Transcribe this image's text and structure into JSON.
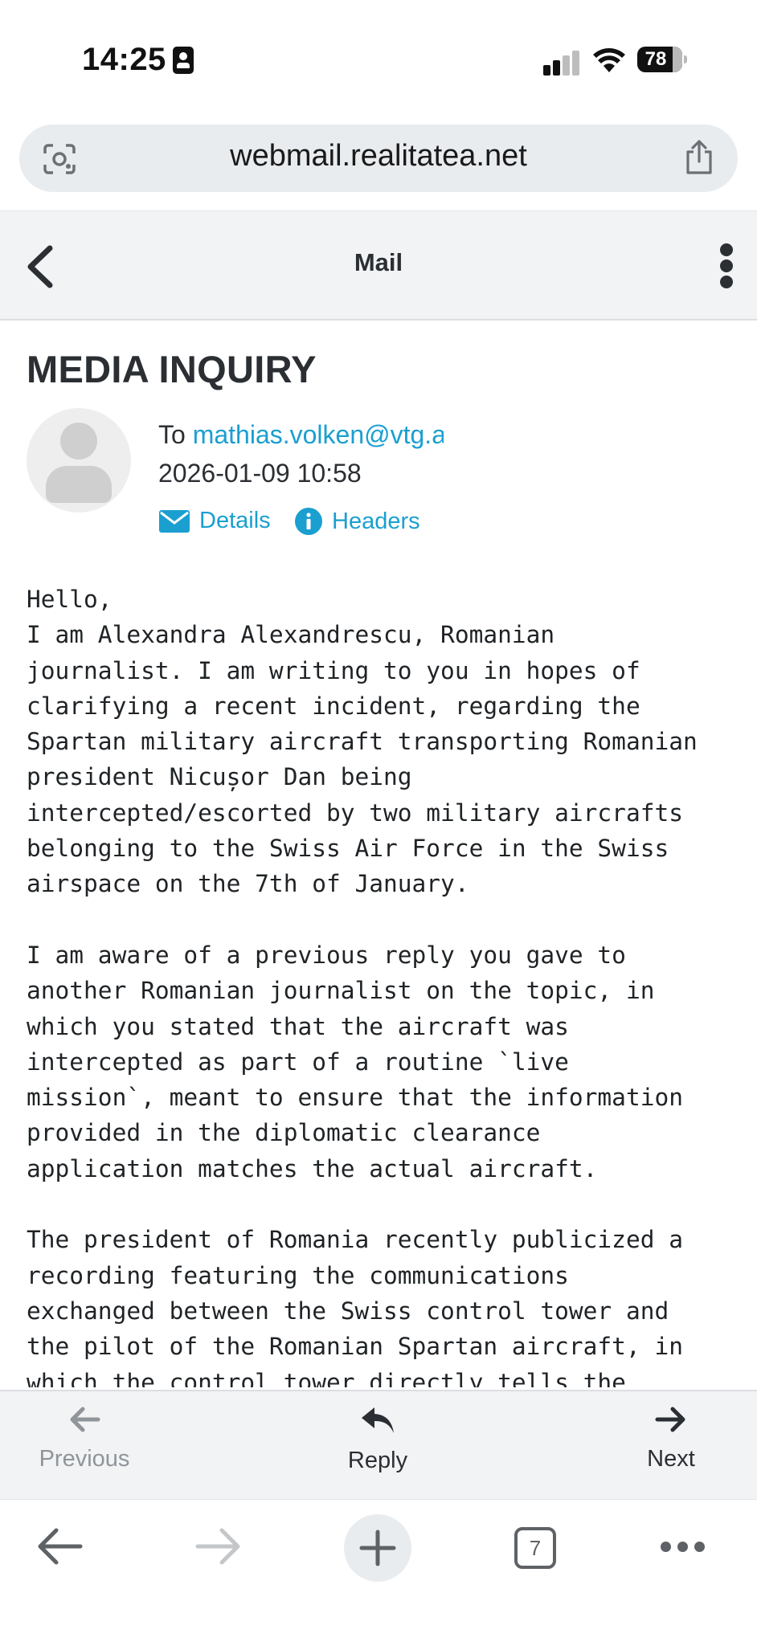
{
  "status_bar": {
    "time": "14:25",
    "battery": "78"
  },
  "browser": {
    "url": "webmail.realitatea.net",
    "tab_count": "7"
  },
  "mail_header": {
    "title": "Mail"
  },
  "message": {
    "subject": "MEDIA INQUIRY",
    "to_label": "To",
    "to_address": "mathias.volken@vtg.admin.ch",
    "date": "2026-01-09 10:58",
    "details_label": "Details",
    "headers_label": "Headers",
    "body": "Hello,\nI am Alexandra Alexandrescu, Romanian\njournalist. I am writing to you in hopes of\nclarifying a recent incident, regarding the\nSpartan military aircraft transporting Romanian\npresident Nicușor Dan being\nintercepted/escorted by two military aircrafts\nbelonging to the Swiss Air Force in the Swiss\nairspace on the 7th of January.\n\nI am aware of a previous reply you gave to\nanother Romanian journalist on the topic, in\nwhich you stated that the aircraft was\nintercepted as part of a routine `live\nmission`, meant to ensure that the information\nprovided in the diplomatic clearance\napplication matches the actual aircraft.\n\nThe president of Romania recently publicized a\nrecording featuring the communications\nexchanged between the Swiss control tower and\nthe pilot of the Romanian Spartan aircraft, in\nwhich the control tower directly tells the"
  },
  "mail_toolbar": {
    "previous": "Previous",
    "reply": "Reply",
    "next": "Next"
  },
  "icons": {
    "status": [
      "id-card-icon",
      "signal-icon",
      "wifi-icon",
      "battery-icon"
    ],
    "url_bar": [
      "lens-icon",
      "share-icon"
    ],
    "header": [
      "chevron-left-icon",
      "more-vertical-icon"
    ],
    "links": [
      "envelope-icon",
      "info-icon"
    ],
    "toolbar": [
      "arrow-left-icon",
      "reply-icon",
      "arrow-right-icon"
    ],
    "browser": [
      "back-arrow-icon",
      "forward-arrow-icon",
      "plus-icon",
      "tabs-icon",
      "more-horizontal-icon"
    ]
  },
  "colors": {
    "link": "#1a9fd0",
    "text": "#2b2f33",
    "toolbar_bg": "#f2f3f4",
    "disabled": "#8f959a"
  }
}
